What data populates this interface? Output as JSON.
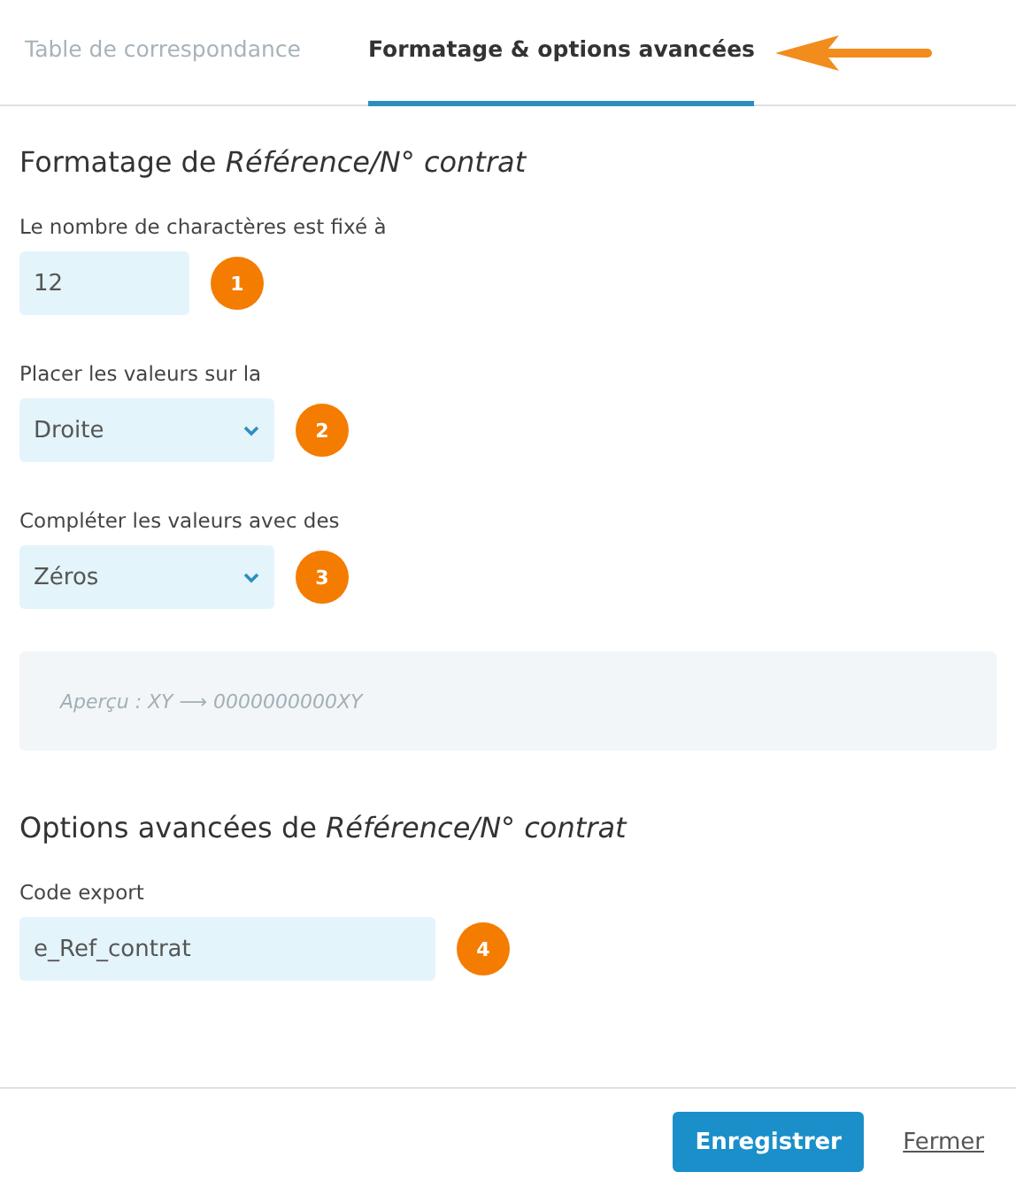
{
  "tabs": [
    {
      "label": "Table de correspondance",
      "selected": false
    },
    {
      "label": "Formatage & options avancées",
      "selected": true
    }
  ],
  "sections": [
    {
      "title": "Formatage de *Référence/N° contrat*",
      "fields": [
        {
          "label": "Le nombre de charactères est fixé à",
          "kind": "input",
          "value": "12",
          "badge": "1"
        },
        {
          "label": "Placer les valeurs sur la",
          "kind": "select",
          "value": "Droite",
          "badge": "2"
        },
        {
          "label": "Compléter les valeurs avec des",
          "kind": "select",
          "value": "Zéros",
          "badge": "3"
        }
      ],
      "preview": "Aperçu : XY ⟶ 0000000000XY"
    },
    {
      "title": "Options avancées de *Référence/N° contrat*",
      "fields": [
        {
          "label": "Code export",
          "kind": "input",
          "value": "e_Ref_contrat",
          "badge": "4"
        }
      ]
    }
  ],
  "buttons": [
    {
      "label": "Enregistrer",
      "kind": "primary"
    },
    {
      "label": "Fermer",
      "kind": "link"
    }
  ]
}
